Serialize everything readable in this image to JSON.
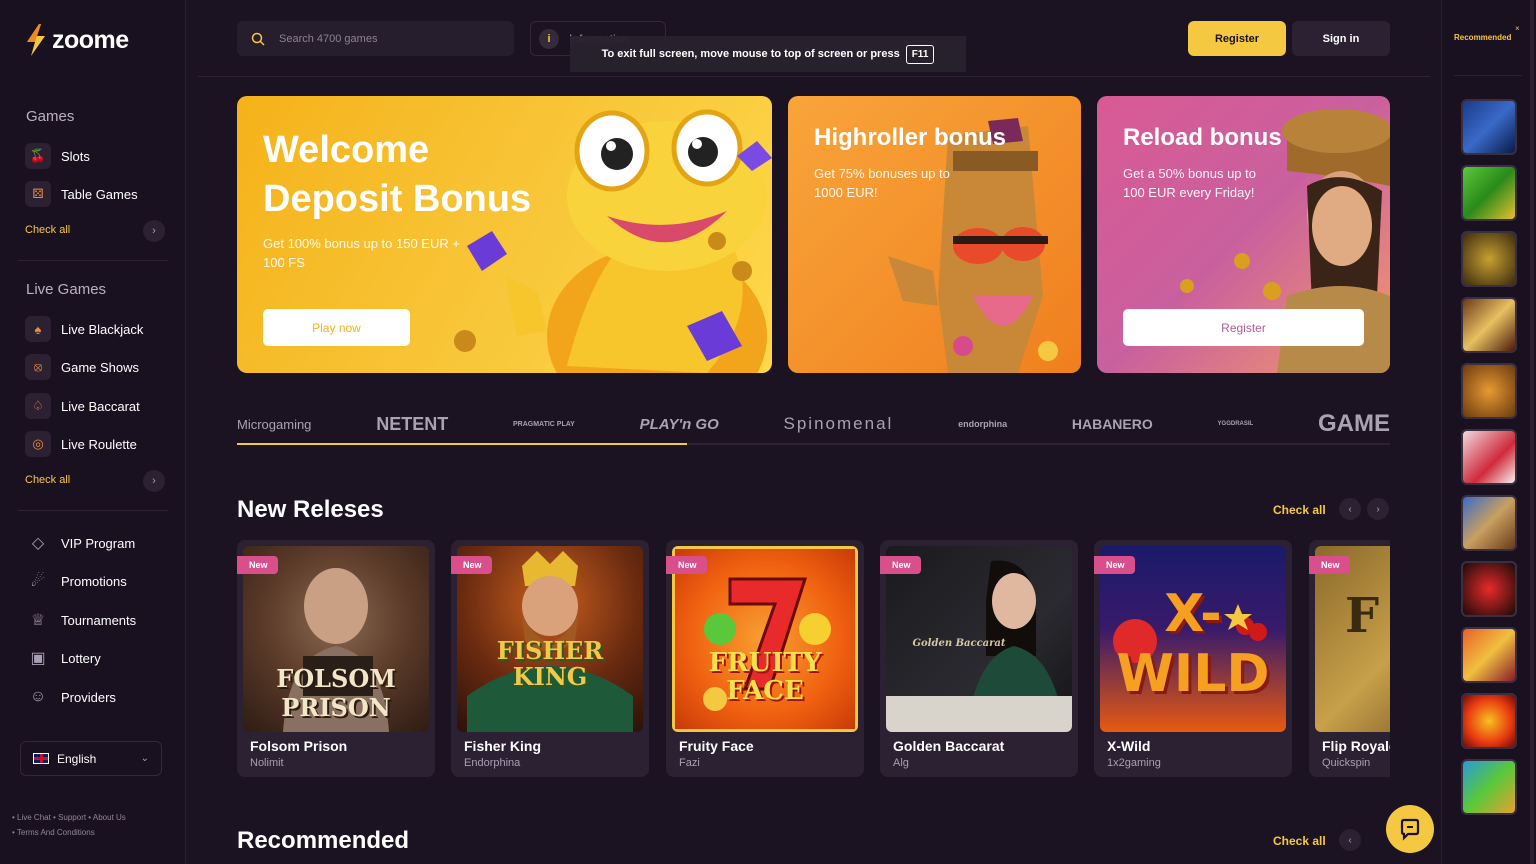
{
  "brand": {
    "name": "zoome"
  },
  "sidebar": {
    "games_title": "Games",
    "games_items": [
      {
        "label": "Slots",
        "icon": "cherry-icon"
      },
      {
        "label": "Table Games",
        "icon": "dice-icon"
      }
    ],
    "live_title": "Live Games",
    "live_items": [
      {
        "label": "Live Blackjack",
        "icon": "card-icon"
      },
      {
        "label": "Game Shows",
        "icon": "wheel-icon"
      },
      {
        "label": "Live Baccarat",
        "icon": "spade-icon"
      },
      {
        "label": "Live Roulette",
        "icon": "roulette-icon"
      }
    ],
    "check_all": "Check all",
    "menu_items": [
      {
        "label": "VIP Program",
        "icon": "diamond-icon"
      },
      {
        "label": "Promotions",
        "icon": "megaphone-icon"
      },
      {
        "label": "Tournaments",
        "icon": "trophy-icon"
      },
      {
        "label": "Lottery",
        "icon": "ticket-icon"
      },
      {
        "label": "Providers",
        "icon": "user-icon"
      }
    ],
    "language": "English",
    "footer_line1": "• Live Chat • Support • About Us",
    "footer_line2": "• Terms And Conditions"
  },
  "header": {
    "search_placeholder": "Search 4700 games",
    "info_label": "Information",
    "register": "Register",
    "sign_in": "Sign in"
  },
  "fullscreen_toast": {
    "text": "To exit full screen, move mouse to top of screen or press",
    "key": "F11"
  },
  "banners": [
    {
      "title": "Welcome Deposit Bonus",
      "desc": "Get 100% bonus up to 150 EUR + 100 FS",
      "button": "Play now"
    },
    {
      "title": "Highroller bonus",
      "desc": "Get 75% bonuses up to 1000 EUR!"
    },
    {
      "title": "Reload bonus",
      "desc": "Get a 50% bonus up to 100 EUR every Friday!",
      "button": "Register"
    }
  ],
  "providers": [
    "Microgaming",
    "NETENT",
    "PRAGMATIC PLAY",
    "PLAY'n GO",
    "Spinomenal",
    "endorphina",
    "HABANERO",
    "YGGDRASIL",
    "GAME"
  ],
  "providers_scroll_progress": 0.39,
  "new_releases": {
    "title": "New Releses",
    "check_all": "Check all",
    "badge": "New",
    "games": [
      {
        "name": "Folsom Prison",
        "provider": "Nolimit",
        "art": "FOLSOM PRISON"
      },
      {
        "name": "Fisher King",
        "provider": "Endorphina",
        "art": "FISHER KING"
      },
      {
        "name": "Fruity Face",
        "provider": "Fazi",
        "art": "FRUITY FACE"
      },
      {
        "name": "Golden Baccarat",
        "provider": "Alg",
        "art": "Golden Baccarat"
      },
      {
        "name": "X-Wild",
        "provider": "1x2gaming",
        "art": "X-WILD"
      },
      {
        "name": "Flip Royale",
        "provider": "Quickspin",
        "art": "F RO"
      }
    ]
  },
  "recommended": {
    "title": "Recommended",
    "check_all": "Check all"
  },
  "rail": {
    "title": "Recommended",
    "close": "×",
    "thumb_count": 11
  },
  "colors": {
    "accent": "#f5c842",
    "bg": "#1b1222",
    "card": "#2b2133",
    "badge": "#d94f8c"
  }
}
